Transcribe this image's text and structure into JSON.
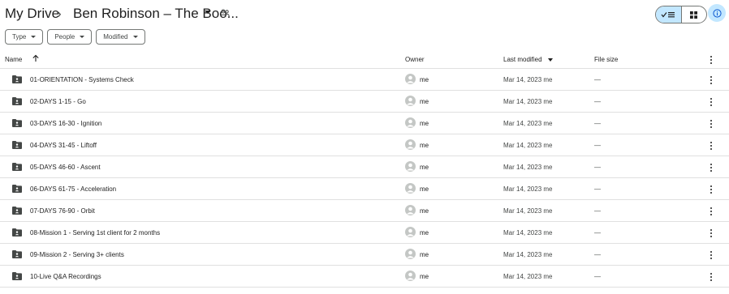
{
  "breadcrumb": {
    "root": "My Drive",
    "separator": "›",
    "current": "Ben Robinson – The Boo..."
  },
  "icons": {
    "dropdown": "caret-down-icon",
    "shared": "shared-people-icon",
    "list_view": "check-list-icon",
    "grid_view": "grid-icon",
    "info": "info-icon",
    "folder": "shared-folder-icon",
    "avatar": "person-avatar-icon",
    "more": "more-vert-icon",
    "sort": "arrow-up-icon"
  },
  "colors": {
    "accent": "#c2e7ff",
    "text": "#1f1f1f",
    "muted": "#444746",
    "divider": "#e0e0e0",
    "folder": "#444746",
    "avatar": "#c4c7c5"
  },
  "filters": [
    "Type",
    "People",
    "Modified"
  ],
  "columns": {
    "name": "Name",
    "owner": "Owner",
    "last_modified": "Last modified",
    "file_size": "File size"
  },
  "rows": [
    {
      "name": "01-ORIENTATION - Systems Check",
      "owner": "me",
      "modified": "Mar 14, 2023 me",
      "size": "—"
    },
    {
      "name": "02-DAYS 1-15 - Go",
      "owner": "me",
      "modified": "Mar 14, 2023 me",
      "size": "—"
    },
    {
      "name": "03-DAYS 16-30 - Ignition",
      "owner": "me",
      "modified": "Mar 14, 2023 me",
      "size": "—"
    },
    {
      "name": "04-DAYS 31-45 - Liftoff",
      "owner": "me",
      "modified": "Mar 14, 2023 me",
      "size": "—"
    },
    {
      "name": "05-DAYS 46-60 - Ascent",
      "owner": "me",
      "modified": "Mar 14, 2023 me",
      "size": "—"
    },
    {
      "name": "06-DAYS 61-75 - Acceleration",
      "owner": "me",
      "modified": "Mar 14, 2023 me",
      "size": "—"
    },
    {
      "name": "07-DAYS 76-90 - Orbit",
      "owner": "me",
      "modified": "Mar 14, 2023 me",
      "size": "—"
    },
    {
      "name": "08-Mission 1 - Serving 1st client for 2 months",
      "owner": "me",
      "modified": "Mar 14, 2023 me",
      "size": "—"
    },
    {
      "name": "09-Mission 2 - Serving 3+ clients",
      "owner": "me",
      "modified": "Mar 14, 2023 me",
      "size": "—"
    },
    {
      "name": "10-Live Q&A Recordings",
      "owner": "me",
      "modified": "Mar 14, 2023 me",
      "size": "—"
    }
  ]
}
